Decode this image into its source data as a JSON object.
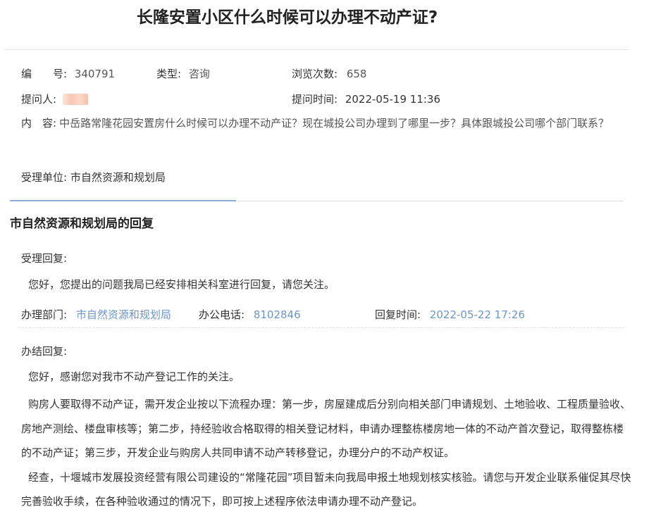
{
  "title": "长隆安置小区什么时候可以办理不动产证?",
  "info": {
    "number_label": "编　　号:",
    "number_value": "340791",
    "type_label": "类型:",
    "type_value": "咨询",
    "views_label": "浏览次数:",
    "views_value": "658",
    "asker_label": "提问人:",
    "ask_time_label": "提问时间:",
    "ask_time_value": "2022-05-19 11:36",
    "content_label": "内　容:",
    "content_value": "中岳路常隆花园安置房什么时候可以办理不动产证？现在城投公司办理到了哪里一步？具体跟城投公司哪个部门联系？",
    "handler_label": "受理单位:",
    "handler_value": "市自然资源和规划局"
  },
  "reply": {
    "section_title": "市自然资源和规划局的回复",
    "accept_label": "受理回复:",
    "accept_text": "您好，您提出的问题我局已经安排相关科室进行回复，请您关注。",
    "dept_label": "办理部门:",
    "dept_value": "市自然资源和规划局",
    "phone_label": "办公电话:",
    "phone_value": "8102846",
    "reply_time_label": "回复时间:",
    "reply_time_value": "2022-05-22 17:26",
    "final_label": "办结回复:",
    "final_greeting": "您好，感谢您对我市不动产登记工作的关注。",
    "final_paragraphs": [
      "购房人要取得不动产证，需开发企业按以下流程办理：第一步，房屋建成后分别向相关部门申请规划、土地验收、工程质量验收、房地产测绘、楼盘审核等；第二步，持经验收合格取得的相关登记材料，申请办理整栋楼房地一体的不动产首次登记，取得整栋楼的不动产证；第三步，开发企业与购房人共同申请不动产转移登记，办理分户的不动产权证。",
      "经查，十堰城市发展投资经营有限公司建设的“常隆花园”项目暂未向我局申报土地规划核实核验。请您与开发企业联系催促其尽快完善验收手续，在各种验收通过的情况下，即可按上述程序依法申请办理不动产登记。"
    ]
  }
}
